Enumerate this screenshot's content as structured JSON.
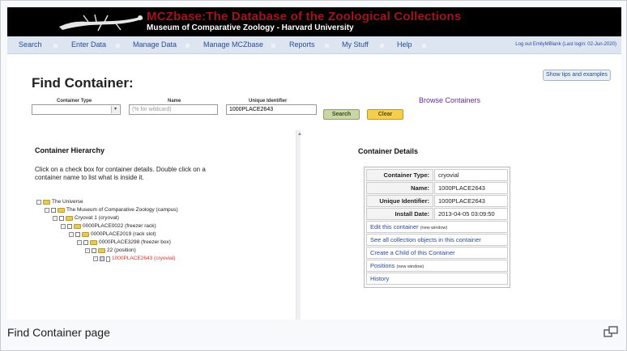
{
  "banner": {
    "title": "MCZbase:The Database of the Zoological Collections",
    "subtitle": "Museum of Comparative Zoology - Harvard University"
  },
  "nav": {
    "items": [
      "Search",
      "Enter Data",
      "Manage Data",
      "Manage MCZbase",
      "Reports",
      "My Stuff",
      "Help"
    ],
    "logout": "Log out EmilyMBlank",
    "last_login": "(Last login: 02-Jun-2020)"
  },
  "page": {
    "title": "Find Container:",
    "tips_button": "Show tips and examples"
  },
  "form": {
    "type_label": "Container Type",
    "type_value": "",
    "name_label": "Name",
    "name_placeholder": "(% for wildcard)",
    "uid_label": "Unique Identifier",
    "uid_value": "1000PLACE2643",
    "search_button": "Search",
    "clear_button": "Clear",
    "browse_link": "Browse Containers"
  },
  "hierarchy": {
    "title": "Container Hierarchy",
    "hint": "Click on a check box for container details. Double click on a container name to list what is inside it.",
    "nodes": [
      {
        "label": "The Universe",
        "depth": 0,
        "checkbox": false,
        "icon": "folder-icon",
        "selected": false
      },
      {
        "label": "The Museum of Comparative Zoology (campus)",
        "depth": 1,
        "checkbox": true,
        "icon": "folder-icon",
        "selected": false
      },
      {
        "label": "Cryovat 1 (cryovat)",
        "depth": 2,
        "checkbox": true,
        "icon": "folder-icon",
        "selected": false
      },
      {
        "label": "0000PLACE0022 (freezer rack)",
        "depth": 3,
        "checkbox": true,
        "icon": "folder-icon",
        "selected": false
      },
      {
        "label": "0000PLACE2019 (rack slot)",
        "depth": 4,
        "checkbox": true,
        "icon": "folder-icon",
        "selected": false
      },
      {
        "label": "0000PLACE3298 (freezer box)",
        "depth": 5,
        "checkbox": true,
        "icon": "folder-icon",
        "selected": false
      },
      {
        "label": "22 (position)",
        "depth": 6,
        "checkbox": true,
        "icon": "folder-icon",
        "selected": false
      },
      {
        "label": "1000PLACE2643 (cryovial)",
        "depth": 7,
        "checkbox": true,
        "icon": "document-icon",
        "selected": true
      }
    ]
  },
  "details": {
    "title": "Container Details",
    "rows": [
      {
        "key": "Container Type:",
        "value": "cryovial"
      },
      {
        "key": "Name:",
        "value": "1000PLACE2643"
      },
      {
        "key": "Unique Identifier:",
        "value": "1000PLACE2643"
      },
      {
        "key": "Install Date:",
        "value": "2013-04-05  03:09:50"
      }
    ],
    "links": [
      {
        "label": "Edit this container",
        "note": "(new window)"
      },
      {
        "label": "See all collection objects in this container",
        "note": ""
      },
      {
        "label": "Create a Child of this Container",
        "note": ""
      },
      {
        "label": "Positions",
        "note": "(new window)"
      },
      {
        "label": "History",
        "note": ""
      }
    ]
  },
  "caption": "Find Container page",
  "colors": {
    "banner_bg": "#000000",
    "title_red": "#a0141e",
    "nav_bg": "#dde6f0",
    "link_blue": "#2a4a9a",
    "browse_purple": "#6a2a9a",
    "search_green": "#c9d6a6",
    "clear_yellow": "#f2cf4f",
    "selected_red": "#d9342b"
  }
}
